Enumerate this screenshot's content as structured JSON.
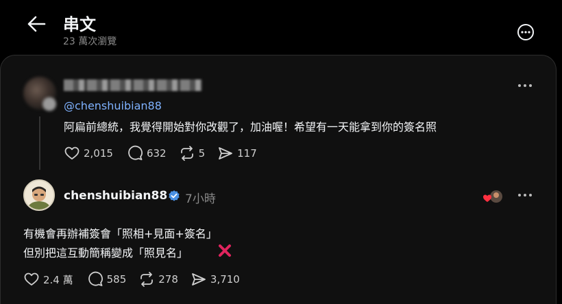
{
  "header": {
    "title": "串文",
    "views": "23 萬次瀏覽"
  },
  "reply": {
    "mention": "@chenshuibian88",
    "text": "阿扁前總統，我覺得開始對你改觀了，加油喔！希望有一天能拿到你的簽名照",
    "likes": "2,015",
    "comments": "632",
    "reposts": "5",
    "shares": "117"
  },
  "post": {
    "username": "chenshuibian88",
    "time": "7小時",
    "line1": "有機會再辦補簽會「照相+見面+簽名」",
    "line2": "但別把這互動簡稱變成「照見名」",
    "likes": "2.4 萬",
    "comments": "585",
    "reposts": "278",
    "shares": "3,710"
  },
  "icons": {
    "back": "arrow-left-icon",
    "more": "ellipsis-icon",
    "like": "heart-icon",
    "comment": "comment-icon",
    "repost": "repost-icon",
    "share": "send-icon",
    "verified": "verified-badge-icon",
    "cross": "cross-mark-icon"
  },
  "colors": {
    "background": "#000000",
    "card": "#101010",
    "mention": "#7fb2ff",
    "verified": "#4a90e2",
    "cross": "#e0245e"
  }
}
